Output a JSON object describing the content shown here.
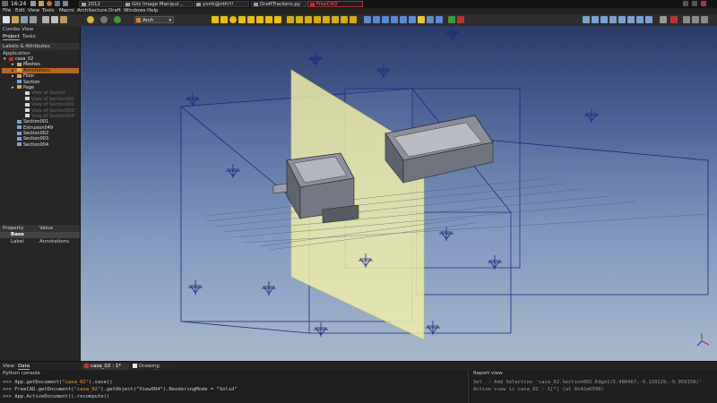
{
  "taskbar": {
    "clock": "16:24",
    "tasks": [
      {
        "label": "2012",
        "active": false
      },
      {
        "label": "Gliz Image Manipul...",
        "active": false
      },
      {
        "label": "yorik@nth!!!",
        "active": false
      },
      {
        "label": "DraftTrackers.py",
        "active": false
      },
      {
        "label": "FreeCAD",
        "active": true
      }
    ]
  },
  "menubar": {
    "items": [
      "File",
      "Edit",
      "View",
      "Tools",
      "Macro",
      "Architecture",
      "Draft",
      "Windows",
      "Help"
    ]
  },
  "toolbar": {
    "workbench": "Arch"
  },
  "combo_view": {
    "title": "Combo View",
    "tabs": [
      "Project",
      "Tasks"
    ],
    "labels_header": "Labels & Attributes",
    "application_label": "Application",
    "tree": [
      {
        "label": "casa_02",
        "level": 0,
        "state": "normal"
      },
      {
        "label": "Meshes",
        "level": 1,
        "state": "normal"
      },
      {
        "label": "Annotations",
        "level": 1,
        "state": "selected"
      },
      {
        "label": "Floor",
        "level": 1,
        "state": "normal"
      },
      {
        "label": "Section",
        "level": 1,
        "state": "normal"
      },
      {
        "label": "Page",
        "level": 1,
        "state": "normal"
      },
      {
        "label": "View of Section",
        "level": 2,
        "state": "dim"
      },
      {
        "label": "View of Section001",
        "level": 2,
        "state": "dim"
      },
      {
        "label": "View of Section002",
        "level": 2,
        "state": "dim"
      },
      {
        "label": "View of Section003",
        "level": 2,
        "state": "dim"
      },
      {
        "label": "View of Section004",
        "level": 2,
        "state": "dim"
      },
      {
        "label": "Section001",
        "level": 1,
        "state": "normal"
      },
      {
        "label": "Extrusion049",
        "level": 1,
        "state": "normal"
      },
      {
        "label": "Section002",
        "level": 1,
        "state": "normal"
      },
      {
        "label": "Section003",
        "level": 1,
        "state": "normal"
      },
      {
        "label": "Section004",
        "level": 1,
        "state": "normal"
      }
    ],
    "property_header": [
      "Property",
      "Value"
    ],
    "group": "Base",
    "properties": [
      {
        "name": "Label",
        "value": "Annotations"
      }
    ],
    "bottom_tabs": [
      "View",
      "Data"
    ]
  },
  "document_tabs": [
    "casa_02 : 1*",
    "Drawing viewer*"
  ],
  "python_console": {
    "title": "Python console",
    "lines": [
      {
        "prompt": ">>> ",
        "pre": "App.getDocument(",
        "str": "\"casa_02\"",
        "post": ").save()"
      },
      {
        "prompt": ">>> ",
        "pre": "FreeCAD.getDocument(",
        "str": "\"casa_02\"",
        "post": ").getObject(\"View004\").RenderingMode = \"Solid\""
      },
      {
        "prompt": ">>> ",
        "pre": "App.ActiveDocument().recompute()",
        "str": "",
        "post": ""
      }
    ]
  },
  "report_view": {
    "title": "Report view",
    "lines": [
      "Sel  : Add Selection 'casa_02.Section002.Edge1(5.486467,-9.118129,-9.959159)'",
      "Active view is casa_02 : 1[*] (at 0x42a0590)"
    ]
  },
  "colors": {
    "accent_selected": "#b7681e",
    "section_plane": "#f3f0a8",
    "arrow_blue": "#1c2580",
    "active_task": "#ff6060"
  }
}
